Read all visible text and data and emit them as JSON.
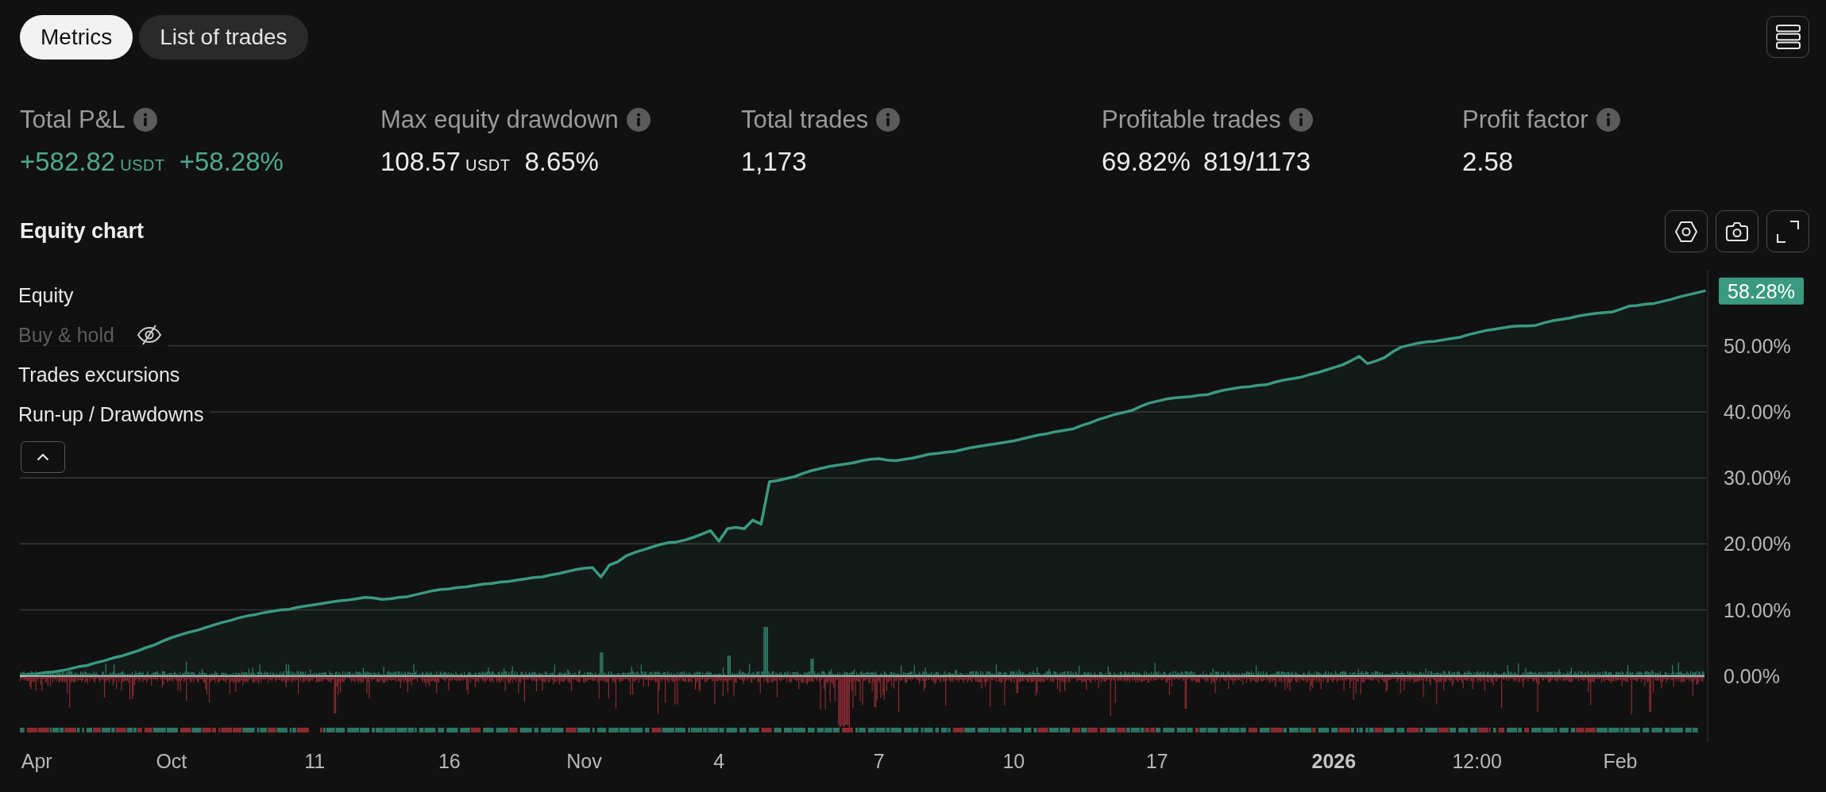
{
  "tabs": [
    {
      "label": "Metrics",
      "selected": true
    },
    {
      "label": "List of trades",
      "selected": false
    }
  ],
  "metrics": [
    {
      "label": "Total P&L",
      "value": "+582.82",
      "unit": "USDT",
      "secondary": "+58.28%",
      "positive": true
    },
    {
      "label": "Max equity drawdown",
      "value": "108.57",
      "unit": "USDT",
      "secondary": "8.65%",
      "positive": false
    },
    {
      "label": "Total trades",
      "value": "1,173",
      "positive": false
    },
    {
      "label": "Profitable trades",
      "value": "69.82%",
      "secondary": "819/1173",
      "positive": false
    },
    {
      "label": "Profit factor",
      "value": "2.58",
      "positive": false
    }
  ],
  "equity_chart": {
    "legend": [
      {
        "visible": true
      },
      {
        "label": "Buy & hold",
        "visible": false
      },
      {
        "label": "Trades excursions",
        "visible": true
      },
      {
        "label": "Run-up / Drawdowns",
        "visible": true
      }
    ],
    "last_value_label": "58.28%",
    "chart_data": {
      "type": "area",
      "title": "Equity chart",
      "grid": true,
      "categories": [
        null,
        null,
        "Apr",
        null,
        null,
        null,
        null,
        null,
        null,
        null,
        null,
        null,
        null,
        null,
        null,
        null,
        null,
        null,
        "Oct",
        null,
        null,
        null,
        null,
        null,
        null,
        null,
        null,
        null,
        null,
        null,
        null,
        null,
        null,
        null,
        null,
        "11",
        null,
        null,
        null,
        null,
        null,
        null,
        null,
        null,
        null,
        null,
        null,
        null,
        null,
        null,
        null,
        "16",
        null,
        null,
        null,
        null,
        null,
        null,
        null,
        null,
        null,
        null,
        null,
        null,
        null,
        null,
        null,
        "Nov",
        null,
        null,
        null,
        null,
        null,
        null,
        null,
        null,
        null,
        null,
        null,
        null,
        null,
        null,
        null,
        "4",
        null,
        null,
        null,
        null,
        null,
        null,
        null,
        null,
        null,
        null,
        null,
        null,
        null,
        null,
        null,
        null,
        null,
        null,
        "7",
        null,
        null,
        null,
        null,
        null,
        null,
        null,
        null,
        null,
        null,
        null,
        null,
        null,
        null,
        null,
        "10",
        null,
        null,
        null,
        null,
        null,
        null,
        null,
        null,
        null,
        null,
        null,
        null,
        null,
        null,
        null,
        null,
        "17",
        null,
        null,
        null,
        null,
        null,
        null,
        null,
        null,
        null,
        null,
        null,
        null,
        null,
        null,
        null,
        null,
        null,
        null,
        null,
        null,
        "2026",
        null,
        null,
        null,
        null,
        null,
        null,
        null,
        null,
        null,
        null,
        null,
        null,
        null,
        null,
        null,
        null,
        "12:00",
        null,
        null,
        null,
        null,
        null,
        null,
        null,
        null,
        null,
        null,
        null,
        null,
        null,
        null,
        null,
        null,
        "Feb",
        null,
        null,
        null,
        null,
        null,
        null,
        null,
        null,
        null,
        null
      ],
      "series": [
        {
          "name": "Equity",
          "color": "#3a9a80",
          "values": [
            0,
            0.2,
            0.3,
            0.5,
            0.6,
            0.8,
            1.1,
            1.4,
            1.6,
            2.0,
            2.3,
            2.7,
            3.0,
            3.4,
            3.8,
            4.3,
            4.7,
            5.3,
            5.8,
            6.2,
            6.6,
            6.9,
            7.3,
            7.7,
            8.1,
            8.4,
            8.8,
            9.1,
            9.3,
            9.6,
            9.8,
            10.0,
            10.1,
            10.4,
            10.6,
            10.8,
            11.0,
            11.2,
            11.4,
            11.5,
            11.7,
            11.9,
            11.8,
            11.6,
            11.7,
            11.9,
            12.0,
            12.3,
            12.6,
            12.9,
            13.1,
            13.2,
            13.4,
            13.5,
            13.7,
            13.9,
            14.0,
            14.2,
            14.3,
            14.5,
            14.7,
            14.9,
            15.0,
            15.3,
            15.5,
            15.8,
            16.1,
            16.3,
            16.4,
            15.0,
            16.8,
            17.3,
            18.2,
            18.7,
            19.1,
            19.5,
            19.9,
            20.2,
            20.3,
            20.6,
            21.0,
            21.5,
            22.0,
            20.4,
            22.3,
            22.5,
            22.3,
            23.6,
            23.0,
            29.4,
            29.6,
            29.9,
            30.2,
            30.7,
            31.1,
            31.4,
            31.7,
            31.9,
            32.1,
            32.3,
            32.6,
            32.8,
            32.9,
            32.7,
            32.6,
            32.8,
            33.0,
            33.3,
            33.6,
            33.7,
            33.9,
            34.0,
            34.3,
            34.6,
            34.8,
            35.0,
            35.2,
            35.4,
            35.6,
            35.9,
            36.2,
            36.5,
            36.7,
            37.0,
            37.2,
            37.4,
            37.9,
            38.3,
            38.8,
            39.2,
            39.6,
            39.9,
            40.2,
            40.8,
            41.3,
            41.6,
            41.9,
            42.1,
            42.2,
            42.3,
            42.5,
            42.6,
            43.0,
            43.3,
            43.5,
            43.7,
            43.8,
            44.0,
            44.1,
            44.5,
            44.8,
            45.0,
            45.2,
            45.6,
            45.9,
            46.3,
            46.7,
            47.1,
            47.7,
            48.4,
            47.3,
            47.7,
            48.2,
            49.1,
            49.8,
            50.1,
            50.4,
            50.6,
            50.7,
            50.9,
            51.1,
            51.3,
            51.7,
            52.0,
            52.3,
            52.5,
            52.7,
            52.9,
            53.0,
            53.0,
            53.1,
            53.5,
            53.8,
            54.0,
            54.2,
            54.5,
            54.7,
            54.9,
            55.0,
            55.1,
            55.5,
            56.0,
            56.1,
            56.3,
            56.4,
            56.7,
            57.0,
            57.4,
            57.7,
            58.0,
            58.3
          ]
        }
      ],
      "ylim": [
        -10,
        61.5
      ],
      "yticks": [
        {
          "value": 0,
          "label": "0.00%"
        },
        {
          "value": 10,
          "label": "10.00%"
        },
        {
          "value": 20,
          "label": "20.00%"
        },
        {
          "value": 30,
          "label": "30.00%"
        },
        {
          "value": 40,
          "label": "40.00%"
        },
        {
          "value": 50,
          "label": "50.00%"
        }
      ]
    }
  }
}
